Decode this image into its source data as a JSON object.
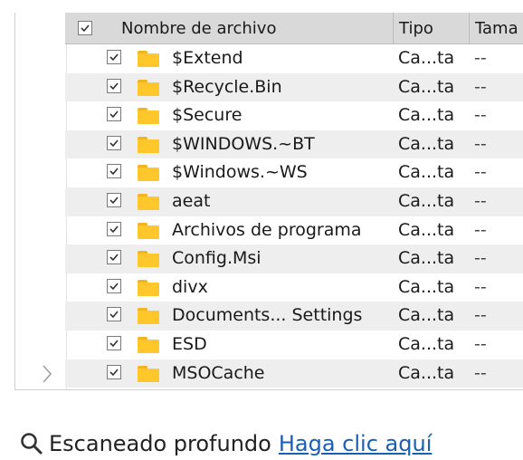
{
  "header": {
    "name_label": "Nombre de archivo",
    "type_label": "Tipo",
    "size_label": "Tama"
  },
  "files": [
    {
      "name": "$Extend",
      "type": "Ca...ta",
      "size": "--",
      "checked": true
    },
    {
      "name": "$Recycle.Bin",
      "type": "Ca...ta",
      "size": "--",
      "checked": true
    },
    {
      "name": "$Secure",
      "type": "Ca...ta",
      "size": "--",
      "checked": true
    },
    {
      "name": "$WINDOWS.~BT",
      "type": "Ca...ta",
      "size": "--",
      "checked": true
    },
    {
      "name": "$Windows.~WS",
      "type": "Ca...ta",
      "size": "--",
      "checked": true
    },
    {
      "name": "aeat",
      "type": "Ca...ta",
      "size": "--",
      "checked": true
    },
    {
      "name": "Archivos de programa",
      "type": "Ca...ta",
      "size": "--",
      "checked": true
    },
    {
      "name": "Config.Msi",
      "type": "Ca...ta",
      "size": "--",
      "checked": true
    },
    {
      "name": "divx",
      "type": "Ca...ta",
      "size": "--",
      "checked": true
    },
    {
      "name": "Documents... Settings",
      "type": "Ca...ta",
      "size": "--",
      "checked": true
    },
    {
      "name": "ESD",
      "type": "Ca...ta",
      "size": "--",
      "checked": true
    },
    {
      "name": "MSOCache",
      "type": "Ca...ta",
      "size": "--",
      "checked": true
    }
  ],
  "footer": {
    "scan_label": "Escaneado profundo",
    "link_label": "Haga clic aquí"
  },
  "icons": {
    "folder": "folder-icon",
    "search": "search-icon",
    "expand": "chevron-right-icon"
  },
  "colors": {
    "folder": "#ffc72c",
    "link": "#1a5fb4",
    "header_bg": "#d9d9d9"
  }
}
